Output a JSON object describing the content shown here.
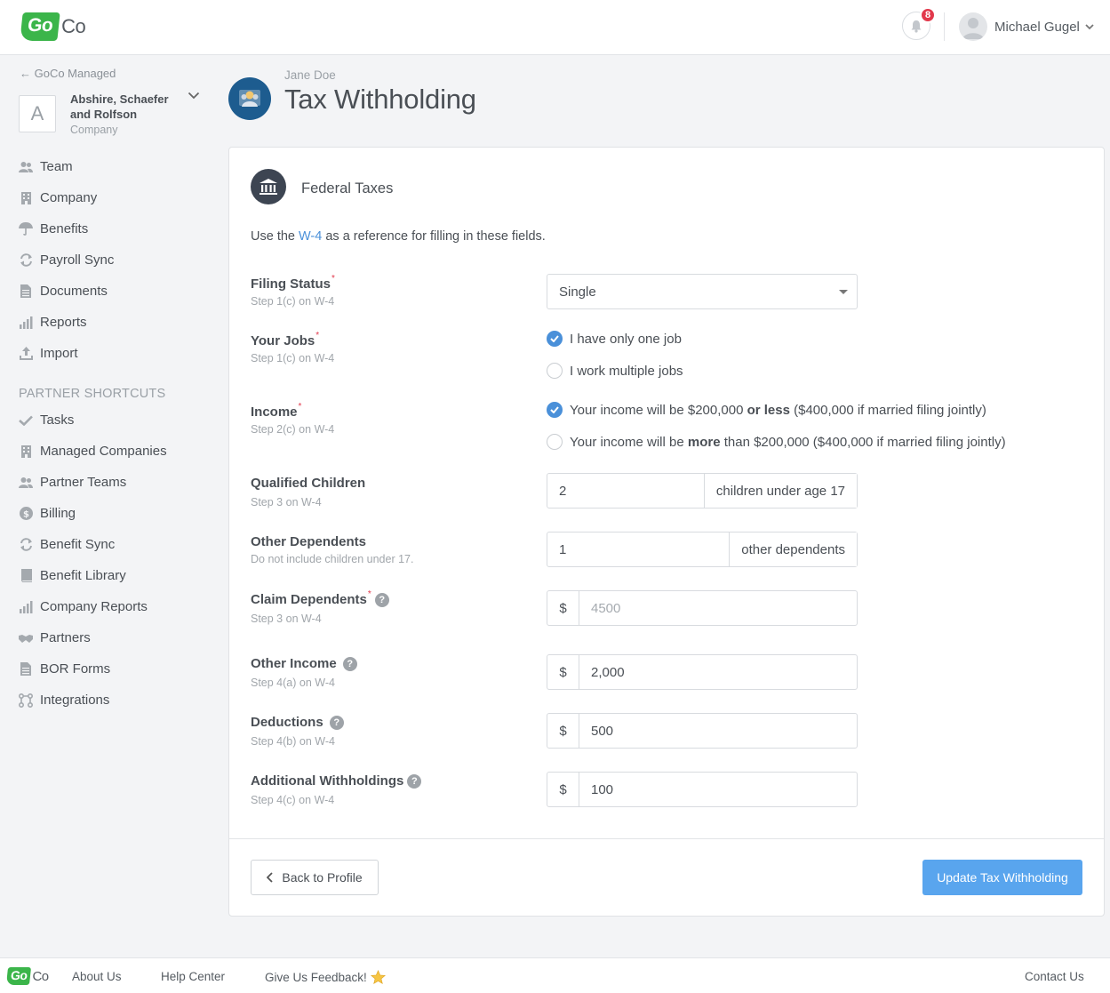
{
  "header": {
    "logo_go": "Go",
    "logo_co": "Co",
    "notification_count": "8",
    "user_name": "Michael Gugel"
  },
  "sidebar": {
    "back_label": "← GoCo Managed",
    "company_initial": "A",
    "company_name": "Abshire, Schaefer and Rolfson",
    "company_type": "Company",
    "items": [
      {
        "label": "Team",
        "icon": "people-icon"
      },
      {
        "label": "Company",
        "icon": "building-icon"
      },
      {
        "label": "Benefits",
        "icon": "umbrella-icon"
      },
      {
        "label": "Payroll Sync",
        "icon": "sync-icon"
      },
      {
        "label": "Documents",
        "icon": "document-icon"
      },
      {
        "label": "Reports",
        "icon": "bar-chart-icon"
      },
      {
        "label": "Import",
        "icon": "upload-icon"
      }
    ],
    "partner_title": "PARTNER SHORTCUTS",
    "partner_items": [
      {
        "label": "Tasks",
        "icon": "check-icon"
      },
      {
        "label": "Managed Companies",
        "icon": "building-icon"
      },
      {
        "label": "Partner Teams",
        "icon": "people-icon"
      },
      {
        "label": "Billing",
        "icon": "dollar-icon"
      },
      {
        "label": "Benefit Sync",
        "icon": "sync-icon"
      },
      {
        "label": "Benefit Library",
        "icon": "book-icon"
      },
      {
        "label": "Company Reports",
        "icon": "bar-chart-icon"
      },
      {
        "label": "Partners",
        "icon": "handshake-icon"
      },
      {
        "label": "BOR Forms",
        "icon": "document-icon"
      },
      {
        "label": "Integrations",
        "icon": "integrations-icon"
      }
    ]
  },
  "page": {
    "employee_name": "Jane Doe",
    "title": "Tax Withholding"
  },
  "card": {
    "title": "Federal Taxes",
    "intro_before": "Use the ",
    "intro_link": "W-4",
    "intro_after": " as a reference for filling in these fields."
  },
  "form": {
    "filing_status": {
      "label": "Filing Status",
      "sub": "Step 1(c) on W-4",
      "value": "Single"
    },
    "your_jobs": {
      "label": "Your Jobs",
      "sub": "Step 1(c) on W-4",
      "options": [
        {
          "label": "I have only one job",
          "checked": true
        },
        {
          "label": "I work multiple jobs",
          "checked": false
        }
      ]
    },
    "income": {
      "label": "Income",
      "sub": "Step 2(c) on W-4",
      "opt1_a": "Your income will be $200,000 ",
      "opt1_b": "or less",
      "opt1_c": " ($400,000 if married filing jointly)",
      "opt2_a": "Your income will be ",
      "opt2_b": "more",
      "opt2_c": " than $200,000 ($400,000 if married filing jointly)"
    },
    "qualified_children": {
      "label": "Qualified Children",
      "sub": "Step 3 on W-4",
      "value": "2",
      "addon": "children under age 17"
    },
    "other_dependents": {
      "label": "Other Dependents",
      "sub": "Do not include children under 17.",
      "value": "1",
      "addon": "other dependents"
    },
    "claim_dependents": {
      "label": "Claim Dependents",
      "sub": "Step 3 on W-4",
      "prefix": "$",
      "placeholder": "4500"
    },
    "other_income": {
      "label": "Other Income",
      "sub": "Step 4(a) on W-4",
      "prefix": "$",
      "value": "2,000"
    },
    "deductions": {
      "label": "Deductions",
      "sub": "Step 4(b) on W-4",
      "prefix": "$",
      "value": "500"
    },
    "additional_withholdings": {
      "label": "Additional Withholdings",
      "sub": "Step 4(c) on W-4",
      "prefix": "$",
      "value": "100"
    },
    "help_glyph": "?",
    "required_mark": "*"
  },
  "actions": {
    "back_label": "Back to Profile",
    "update_label": "Update Tax Withholding"
  },
  "footer": {
    "about": "About Us",
    "help": "Help Center",
    "feedback": "Give Us Feedback!",
    "contact": "Contact Us"
  },
  "colors": {
    "brand_green": "#3bb54a",
    "accent_blue": "#4a90d9",
    "button_blue": "#59a5ee",
    "badge_red": "#e2394c"
  }
}
